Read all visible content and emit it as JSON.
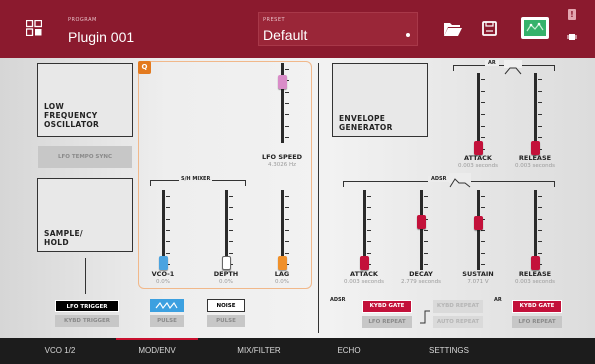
{
  "header": {
    "program_label": "PROGRAM",
    "program_name": "Plugin 001",
    "preset_label": "PRESET",
    "preset_name": "Default",
    "alert_mark": "!"
  },
  "lfo": {
    "title": "LOW\nFREQUENCY\nOSCILLATOR",
    "tempo_sync": "LFO TEMPO SYNC",
    "speed_label": "LFO SPEED",
    "speed_value": "4.3026 Hz",
    "speed_level": 0.82,
    "q_badge": "Q"
  },
  "sh": {
    "title": "SAMPLE/\nHOLD",
    "mixer_label": "S/H MIXER",
    "vco1_label": "VCO-1",
    "vco1_value": "0.0%",
    "vco1_level": 0.0,
    "depth_label": "DEPTH",
    "depth_value": "0.0%",
    "depth_level": 0.0,
    "lag_label": "LAG",
    "lag_value": "0.0%",
    "lag_level": 0.0
  },
  "lfo_trigger": {
    "active": "LFO TRIGGER",
    "inactive": "KYBD TRIGGER"
  },
  "wave": {
    "pulse_top": "PULSE",
    "noise_top": "NOISE",
    "pulse_bottom_1": "PULSE",
    "pulse_bottom_2": "PULSE"
  },
  "env": {
    "title": "ENVELOPE\nGENERATOR",
    "ar_label": "AR",
    "ar_attack_label": "ATTACK",
    "ar_attack_value": "0.003 seconds",
    "ar_attack_level": 0.0,
    "ar_release_label": "RELEASE",
    "ar_release_value": "0.003 seconds",
    "ar_release_level": 0.0,
    "adsr_label": "ADSR",
    "attack_label": "ATTACK",
    "attack_value": "0.003 seconds",
    "attack_level": 0.0,
    "decay_label": "DECAY",
    "decay_value": "2.779 seconds",
    "decay_level": 0.62,
    "sustain_label": "SUSTAIN",
    "sustain_value": "7.071 V",
    "sustain_level": 0.6,
    "release_label": "RELEASE",
    "release_value": "0.003 seconds",
    "release_level": 0.0
  },
  "adsr_gate": {
    "label": "ADSR",
    "kybd_gate": "KYBD GATE",
    "lfo_repeat": "LFO REPEAT",
    "kybd_repeat": "KYBD REPEAT",
    "auto_repeat": "AUTO REPEAT"
  },
  "ar_gate": {
    "label": "AR",
    "kybd_gate": "KYBD GATE",
    "lfo_repeat": "LFO REPEAT"
  },
  "tabs": [
    "VCO 1/2",
    "MOD/ENV",
    "MIX/FILTER",
    "ECHO",
    "SETTINGS"
  ],
  "colors": {
    "header": "#8b1a2e",
    "accent": "#c3113a",
    "lfo_thumb": "#d98cc8",
    "vco_thumb": "#4aa3e0",
    "lag_thumb": "#f0902a",
    "red_thumb": "#c3113a"
  }
}
